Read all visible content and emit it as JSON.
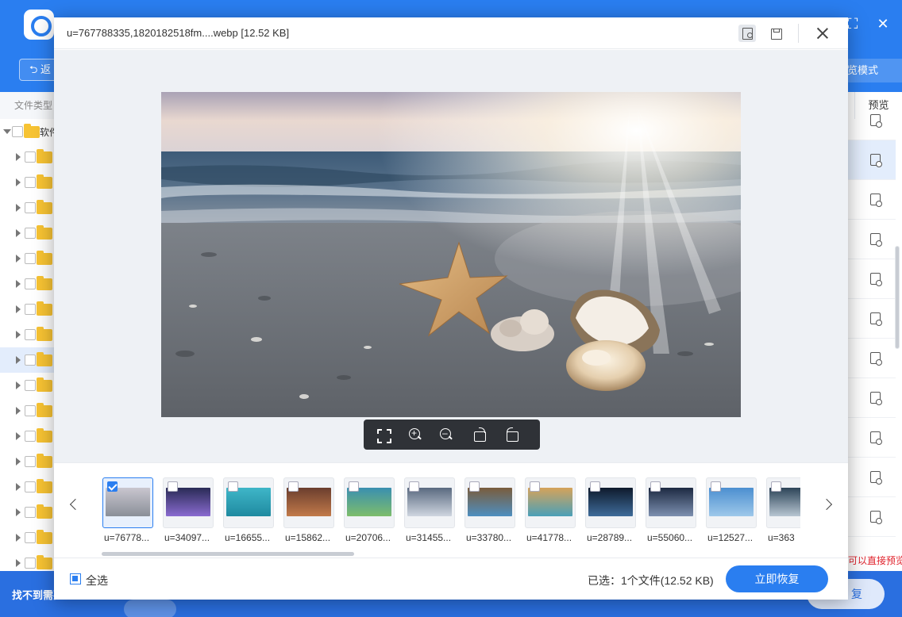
{
  "app": {
    "back_label": "返",
    "mode_label": "览模式",
    "filetype_label": "文件类型",
    "root_folder_label": "软件",
    "preview_header": "预览",
    "hint_text": "可以直接预览",
    "help_text": "找不到需要的文件",
    "recover_label": "复"
  },
  "tree": {
    "rows": [
      {
        "label": "",
        "selected": false
      },
      {
        "label": "",
        "selected": false
      },
      {
        "label": "",
        "selected": false
      },
      {
        "label": "",
        "selected": false
      },
      {
        "label": "",
        "selected": false
      },
      {
        "label": "",
        "selected": false
      },
      {
        "label": "",
        "selected": false
      },
      {
        "label": "",
        "selected": false
      },
      {
        "label": "",
        "selected": true
      },
      {
        "label": "",
        "selected": false
      },
      {
        "label": "",
        "selected": false
      },
      {
        "label": "",
        "selected": false
      },
      {
        "label": "",
        "selected": false
      },
      {
        "label": "",
        "selected": false
      },
      {
        "label": "",
        "selected": false
      },
      {
        "label": "",
        "selected": false
      },
      {
        "label": "",
        "selected": false
      }
    ]
  },
  "modal": {
    "file_title": "u=767788335,1820182518fm....webp [12.52 KB]",
    "select_all_label": "全选",
    "selection_info": "已选：1个文件(12.52 KB)",
    "recover_button": "立即恢复"
  },
  "thumbnails": [
    {
      "name": "u=76778...",
      "checked": true
    },
    {
      "name": "u=34097...",
      "checked": false
    },
    {
      "name": "u=16655...",
      "checked": false
    },
    {
      "name": "u=15862...",
      "checked": false
    },
    {
      "name": "u=20706...",
      "checked": false
    },
    {
      "name": "u=31455...",
      "checked": false
    },
    {
      "name": "u=33780...",
      "checked": false
    },
    {
      "name": "u=41778...",
      "checked": false
    },
    {
      "name": "u=28789...",
      "checked": false
    },
    {
      "name": "u=55060...",
      "checked": false
    },
    {
      "name": "u=12527...",
      "checked": false
    },
    {
      "name": "u=363",
      "checked": false
    }
  ],
  "colors": {
    "brand": "#2a7ef0",
    "hint_red": "#e0212b"
  }
}
